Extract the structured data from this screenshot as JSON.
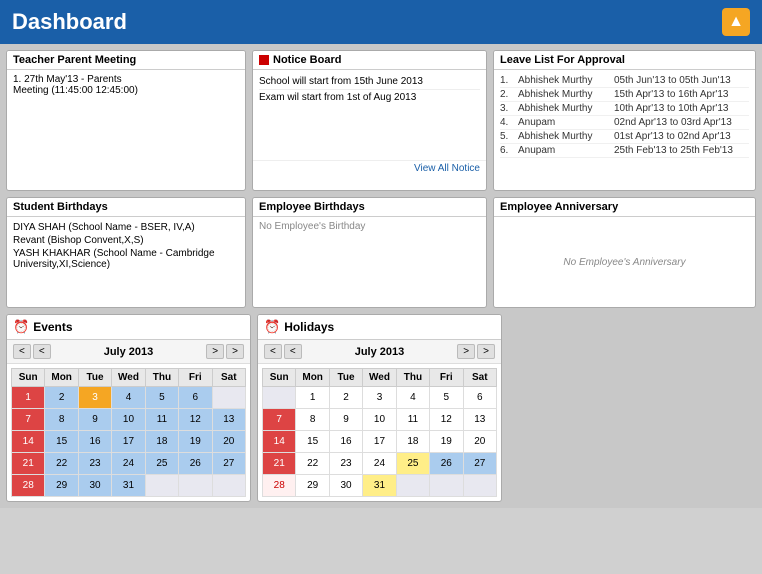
{
  "header": {
    "title": "Dashboard",
    "icon": "▲"
  },
  "teacherParentMeeting": {
    "title": "Teacher Parent Meeting",
    "items": [
      "1. 27th May'13 - Parents",
      "Meeting (11:45:00  12:45:00)"
    ]
  },
  "noticeBoard": {
    "title": "Notice Board",
    "items": [
      "School will start from 15th June 2013",
      "Exam wil start from 1st of Aug 2013"
    ],
    "viewAll": "View All Notice"
  },
  "leaveList": {
    "title": "Leave List For Approval",
    "items": [
      {
        "num": "1.",
        "name": "Abhishek Murthy",
        "dates": "05th Jun'13 to 05th Jun'13"
      },
      {
        "num": "2.",
        "name": "Abhishek Murthy",
        "dates": "15th Apr'13 to 16th Apr'13"
      },
      {
        "num": "3.",
        "name": "Abhishek Murthy",
        "dates": "10th Apr'13 to 10th Apr'13"
      },
      {
        "num": "4.",
        "name": "Anupam",
        "dates": "02nd Apr'13 to 03rd Apr'13"
      },
      {
        "num": "5.",
        "name": "Abhishek Murthy",
        "dates": "01st Apr'13 to 02nd Apr'13"
      },
      {
        "num": "6.",
        "name": "Anupam",
        "dates": "25th Feb'13 to 25th Feb'13"
      }
    ]
  },
  "studentBirthdays": {
    "title": "Student Birthdays",
    "items": [
      "DIYA SHAH (School Name - BSER, IV,A)",
      "Revant (Bishop Convent,X,S)",
      "YASH KHAKHAR (School Name - Cambridge University,XI,Science)"
    ]
  },
  "employeeBirthdays": {
    "title": "Employee Birthdays",
    "noData": "No Employee's Birthday"
  },
  "employeeAnniversary": {
    "title": "Employee Anniversary",
    "noData": "No Employee's Anniversary"
  },
  "eventsCalendar": {
    "title": "Events",
    "month": "July 2013",
    "days": [
      "Sun",
      "Mon",
      "Tue",
      "Wed",
      "Thu",
      "Fri",
      "Sat"
    ],
    "prevPrev": "<",
    "prev": "<",
    "next": ">",
    "nextNext": ">"
  },
  "holidaysCalendar": {
    "title": "Holidays",
    "month": "July 2013",
    "days": [
      "Sun",
      "Mon",
      "Tue",
      "Wed",
      "Thu",
      "Fri",
      "Sat"
    ],
    "prevPrev": "<",
    "prev": "<",
    "next": ">",
    "nextNext": ">"
  }
}
